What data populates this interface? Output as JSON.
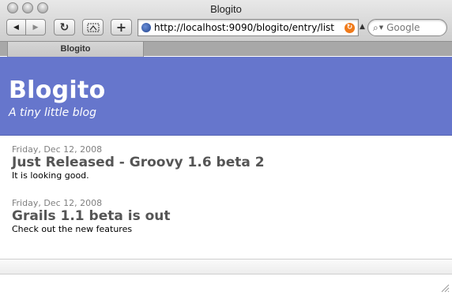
{
  "window": {
    "title": "Blogito"
  },
  "toolbar": {
    "back_icon": "◀",
    "forward_icon": "▶",
    "reload_icon": "↻",
    "add_icon": "+",
    "url": "http://localhost:9090/blogito/entry/list",
    "search_placeholder": "Google"
  },
  "tabs": [
    {
      "label": "Blogito"
    }
  ],
  "site": {
    "title": "Blogito",
    "tagline": "A tiny little blog",
    "header_color": "#6676cc"
  },
  "entries": [
    {
      "date": "Friday, Dec 12, 2008",
      "title": "Just Released - Groovy 1.6 beta 2",
      "body": "It is looking good."
    },
    {
      "date": "Friday, Dec 12, 2008",
      "title": "Grails 1.1 beta is out",
      "body": "Check out the new features"
    }
  ]
}
